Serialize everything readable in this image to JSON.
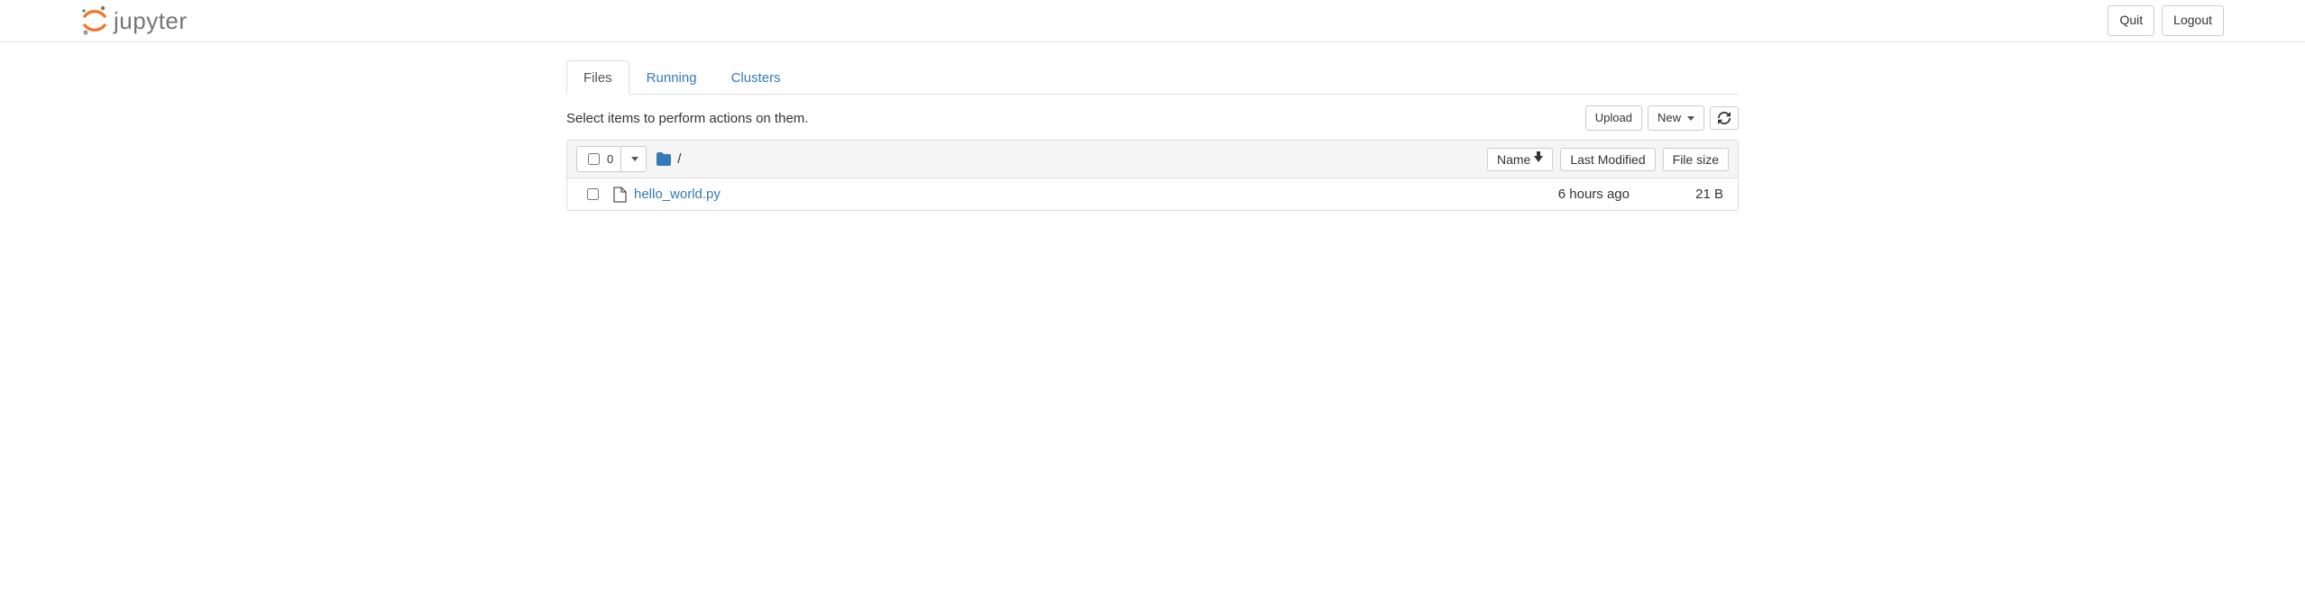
{
  "header": {
    "logo_text": "jupyter",
    "quit_label": "Quit",
    "logout_label": "Logout"
  },
  "tabs": {
    "files": "Files",
    "running": "Running",
    "clusters": "Clusters"
  },
  "toolbar": {
    "hint": "Select items to perform actions on them.",
    "upload_label": "Upload",
    "new_label": "New"
  },
  "list_header": {
    "selected_count": "0",
    "breadcrumb_sep": "/",
    "sort_name_label": "Name",
    "last_modified_label": "Last Modified",
    "file_size_label": "File size"
  },
  "files": [
    {
      "name": "hello_world.py",
      "modified": "6 hours ago",
      "size": "21 B"
    }
  ]
}
